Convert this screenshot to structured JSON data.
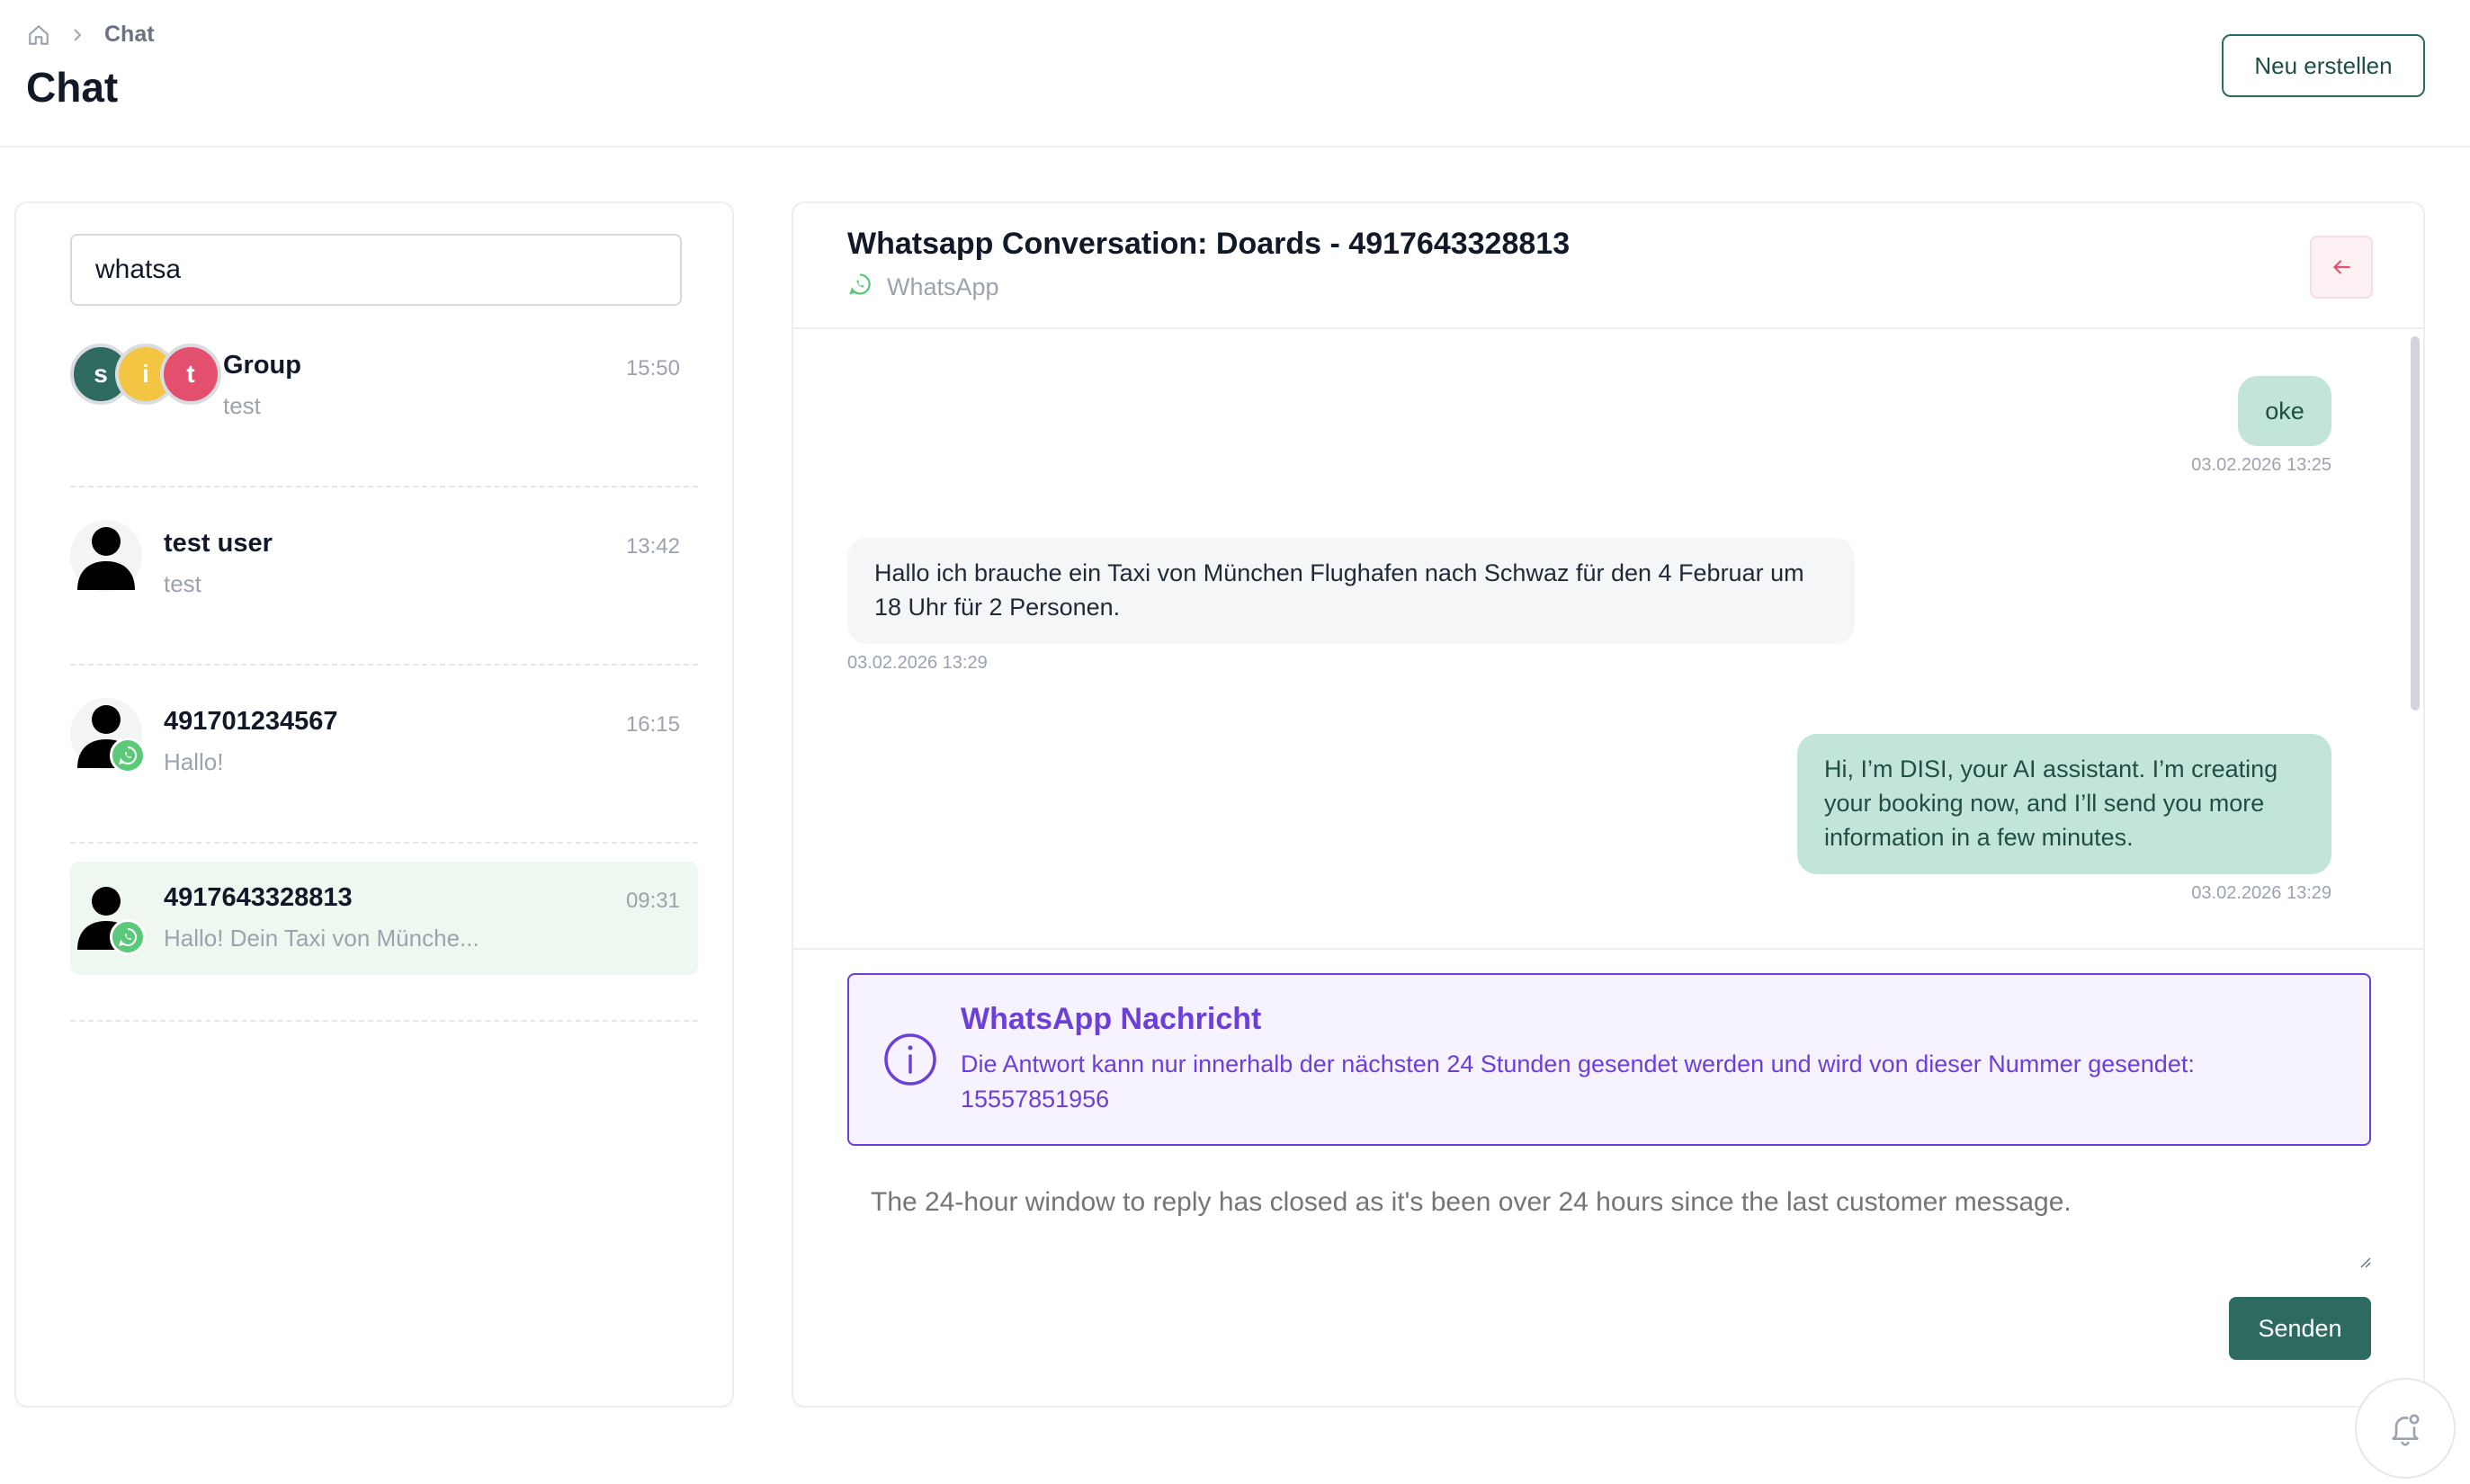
{
  "breadcrumb": {
    "current": "Chat"
  },
  "page": {
    "title": "Chat",
    "new_button": "Neu erstellen"
  },
  "search": {
    "value": "whatsa"
  },
  "conversations": [
    {
      "name": "Group",
      "preview": "test",
      "time": "15:50",
      "avatars": [
        {
          "letter": "s",
          "color": "#2e6a5e"
        },
        {
          "letter": "i",
          "color": "#f4c443"
        },
        {
          "letter": "t",
          "color": "#e2506e"
        }
      ]
    },
    {
      "name": "test user",
      "preview": "test",
      "time": "13:42"
    },
    {
      "name": "491701234567",
      "preview": "Hallo!",
      "time": "16:15"
    },
    {
      "name": "4917643328813",
      "preview": "Hallo! Dein Taxi von Münche...",
      "time": "09:31"
    }
  ],
  "active_conversation": {
    "title": "Whatsapp Conversation: Doards - 4917643328813",
    "channel": "WhatsApp"
  },
  "messages": [
    {
      "direction": "out",
      "text": "oke",
      "timestamp": "03.02.2026 13:25"
    },
    {
      "direction": "in",
      "text": "Hallo ich brauche ein Taxi von München Flughafen nach Schwaz für den 4 Februar um 18 Uhr für 2 Personen.",
      "timestamp": "03.02.2026 13:29"
    },
    {
      "direction": "out",
      "text": "Hi, I’m DISI, your AI assistant. I’m creating your booking now, and I’ll send you more information in a few minutes.",
      "timestamp": "03.02.2026 13:29"
    }
  ],
  "notice": {
    "title": "WhatsApp Nachricht",
    "body": "Die Antwort kann nur innerhalb der nächsten 24 Stunden gesendet werden und wird von dieser Nummer gesendet: 15557851956"
  },
  "reply": {
    "placeholder": "The 24-hour window to reply has closed as it's been over 24 hours since the last customer message."
  },
  "send_button": "Senden",
  "colors": {
    "accent": "#2d6a5f",
    "outgoing_bubble": "#c3e4d9",
    "notice": "#6d3fd9",
    "whatsapp": "#5cc97a"
  }
}
